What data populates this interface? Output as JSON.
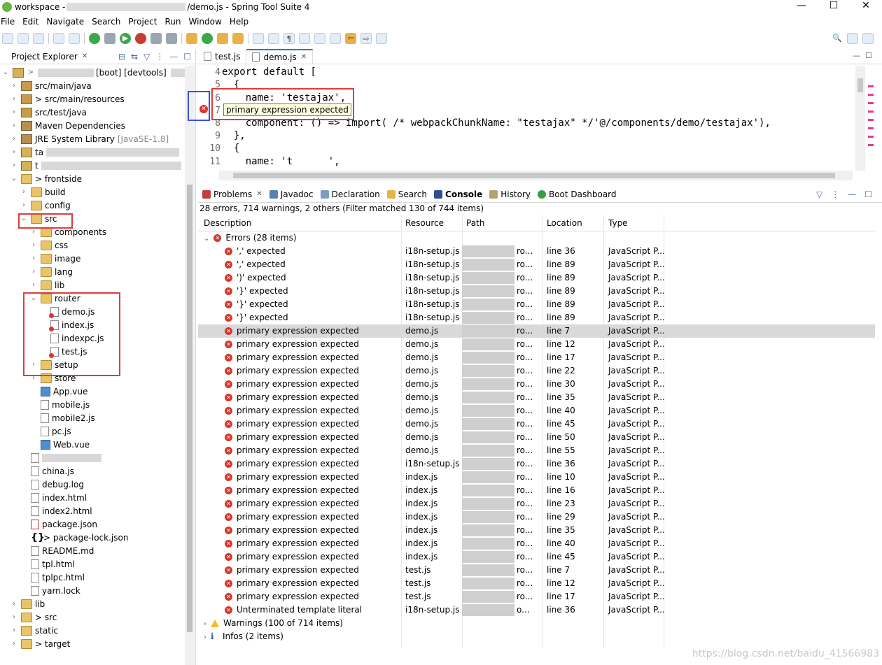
{
  "window": {
    "title_prefix": "workspace - ",
    "title_suffix": "/demo.js - Spring Tool Suite 4",
    "controls": [
      "—",
      "☐",
      "✕"
    ]
  },
  "menu": [
    "File",
    "Edit",
    "Navigate",
    "Search",
    "Project",
    "Run",
    "Window",
    "Help"
  ],
  "explorer": {
    "title": "Project Explorer",
    "root": "[boot] [devtools]",
    "items": [
      {
        "label": "src/main/java"
      },
      {
        "label": "> src/main/resources"
      },
      {
        "label": "src/test/java"
      },
      {
        "label": "Maven Dependencies"
      },
      {
        "label": "JRE System Library",
        "extra": "[JavaSE-1.8]"
      },
      {
        "label": "ta"
      },
      {
        "label": "t"
      },
      {
        "label": "> frontside"
      },
      {
        "label": "build"
      },
      {
        "label": "config"
      },
      {
        "label": "src"
      },
      {
        "label": "components"
      },
      {
        "label": "css"
      },
      {
        "label": "image"
      },
      {
        "label": "lang"
      },
      {
        "label": "lib"
      },
      {
        "label": "router"
      },
      {
        "label": "demo.js"
      },
      {
        "label": "index.js"
      },
      {
        "label": "indexpc.js"
      },
      {
        "label": "test.js"
      },
      {
        "label": "setup"
      },
      {
        "label": "store"
      },
      {
        "label": "App.vue"
      },
      {
        "label": "mobile.js"
      },
      {
        "label": "mobile2.js"
      },
      {
        "label": "pc.js"
      },
      {
        "label": "Web.vue"
      },
      {
        "label": "china.js"
      },
      {
        "label": "debug.log"
      },
      {
        "label": "index.html"
      },
      {
        "label": "index2.html"
      },
      {
        "label": "package.json"
      },
      {
        "label": "> package-lock.json"
      },
      {
        "label": "README.md"
      },
      {
        "label": "tpl.html"
      },
      {
        "label": "tplpc.html"
      },
      {
        "label": "yarn.lock"
      },
      {
        "label": "lib"
      },
      {
        "label": "> src"
      },
      {
        "label": "static"
      },
      {
        "label": "> target"
      }
    ]
  },
  "editor": {
    "tabs": [
      {
        "label": "test.js"
      },
      {
        "label": "demo.js"
      }
    ],
    "lines": [
      {
        "num": "4",
        "text": "export default ["
      },
      {
        "num": "5",
        "text": "  {"
      },
      {
        "num": "6",
        "text": "    name: 'testajax',"
      },
      {
        "num": "7",
        "text": "                  ',"
      },
      {
        "num": "8",
        "text": "    component: () => import( /* webpackChunkName: \"testajax\" */'@/components/demo/testajax'),"
      },
      {
        "num": "9",
        "text": "  },"
      },
      {
        "num": "10",
        "text": "  {"
      },
      {
        "num": "11",
        "text": "    name: 't      ',"
      }
    ],
    "tooltip": "primary expression expected"
  },
  "problems": {
    "tabs": [
      "Problems",
      "Javadoc",
      "Declaration",
      "Search",
      "Console",
      "History",
      "Boot Dashboard"
    ],
    "summary": "28 errors, 714 warnings, 2 others (Filter matched 130 of 744 items)",
    "columns": [
      "Description",
      "Resource",
      "Path",
      "Location",
      "Type"
    ],
    "errors_group": "Errors (28 items)",
    "rows": [
      {
        "desc": "',' expected",
        "res": "i18n-setup.js",
        "path": "ro...",
        "loc": "line 36",
        "type": "JavaScript P..."
      },
      {
        "desc": "',' expected",
        "res": "i18n-setup.js",
        "path": "ro...",
        "loc": "line 89",
        "type": "JavaScript P..."
      },
      {
        "desc": "')' expected",
        "res": "i18n-setup.js",
        "path": "ro...",
        "loc": "line 89",
        "type": "JavaScript P..."
      },
      {
        "desc": "'}' expected",
        "res": "i18n-setup.js",
        "path": "ro...",
        "loc": "line 89",
        "type": "JavaScript P..."
      },
      {
        "desc": "'}' expected",
        "res": "i18n-setup.js",
        "path": "ro...",
        "loc": "line 89",
        "type": "JavaScript P..."
      },
      {
        "desc": "'}' expected",
        "res": "i18n-setup.js",
        "path": "ro...",
        "loc": "line 89",
        "type": "JavaScript P..."
      },
      {
        "desc": "primary expression expected",
        "res": "demo.js",
        "path": "ro...",
        "loc": "line 7",
        "type": "JavaScript P..."
      },
      {
        "desc": "primary expression expected",
        "res": "demo.js",
        "path": "ro...",
        "loc": "line 12",
        "type": "JavaScript P..."
      },
      {
        "desc": "primary expression expected",
        "res": "demo.js",
        "path": "ro...",
        "loc": "line 17",
        "type": "JavaScript P..."
      },
      {
        "desc": "primary expression expected",
        "res": "demo.js",
        "path": "ro...",
        "loc": "line 22",
        "type": "JavaScript P..."
      },
      {
        "desc": "primary expression expected",
        "res": "demo.js",
        "path": "ro...",
        "loc": "line 30",
        "type": "JavaScript P..."
      },
      {
        "desc": "primary expression expected",
        "res": "demo.js",
        "path": "ro...",
        "loc": "line 35",
        "type": "JavaScript P..."
      },
      {
        "desc": "primary expression expected",
        "res": "demo.js",
        "path": "ro...",
        "loc": "line 40",
        "type": "JavaScript P..."
      },
      {
        "desc": "primary expression expected",
        "res": "demo.js",
        "path": "ro...",
        "loc": "line 45",
        "type": "JavaScript P..."
      },
      {
        "desc": "primary expression expected",
        "res": "demo.js",
        "path": "ro...",
        "loc": "line 50",
        "type": "JavaScript P..."
      },
      {
        "desc": "primary expression expected",
        "res": "demo.js",
        "path": "ro...",
        "loc": "line 55",
        "type": "JavaScript P..."
      },
      {
        "desc": "primary expression expected",
        "res": "i18n-setup.js",
        "path": "ro...",
        "loc": "line 36",
        "type": "JavaScript P..."
      },
      {
        "desc": "primary expression expected",
        "res": "index.js",
        "path": "ro...",
        "loc": "line 10",
        "type": "JavaScript P..."
      },
      {
        "desc": "primary expression expected",
        "res": "index.js",
        "path": "ro...",
        "loc": "line 16",
        "type": "JavaScript P..."
      },
      {
        "desc": "primary expression expected",
        "res": "index.js",
        "path": "ro...",
        "loc": "line 23",
        "type": "JavaScript P..."
      },
      {
        "desc": "primary expression expected",
        "res": "index.js",
        "path": "ro...",
        "loc": "line 29",
        "type": "JavaScript P..."
      },
      {
        "desc": "primary expression expected",
        "res": "index.js",
        "path": "ro...",
        "loc": "line 35",
        "type": "JavaScript P..."
      },
      {
        "desc": "primary expression expected",
        "res": "index.js",
        "path": "ro...",
        "loc": "line 40",
        "type": "JavaScript P..."
      },
      {
        "desc": "primary expression expected",
        "res": "index.js",
        "path": "ro...",
        "loc": "line 45",
        "type": "JavaScript P..."
      },
      {
        "desc": "primary expression expected",
        "res": "test.js",
        "path": "ro...",
        "loc": "line 7",
        "type": "JavaScript P..."
      },
      {
        "desc": "primary expression expected",
        "res": "test.js",
        "path": "ro...",
        "loc": "line 12",
        "type": "JavaScript P..."
      },
      {
        "desc": "primary expression expected",
        "res": "test.js",
        "path": "ro...",
        "loc": "line 17",
        "type": "JavaScript P..."
      },
      {
        "desc": "Unterminated template literal",
        "res": "i18n-setup.js",
        "path": "o...",
        "loc": "line 36",
        "type": "JavaScript P..."
      }
    ],
    "warnings_group": "Warnings (100 of 714 items)",
    "infos_group": "Infos (2 items)",
    "watermark": "https://blog.csdn.net/baidu_41566983"
  }
}
